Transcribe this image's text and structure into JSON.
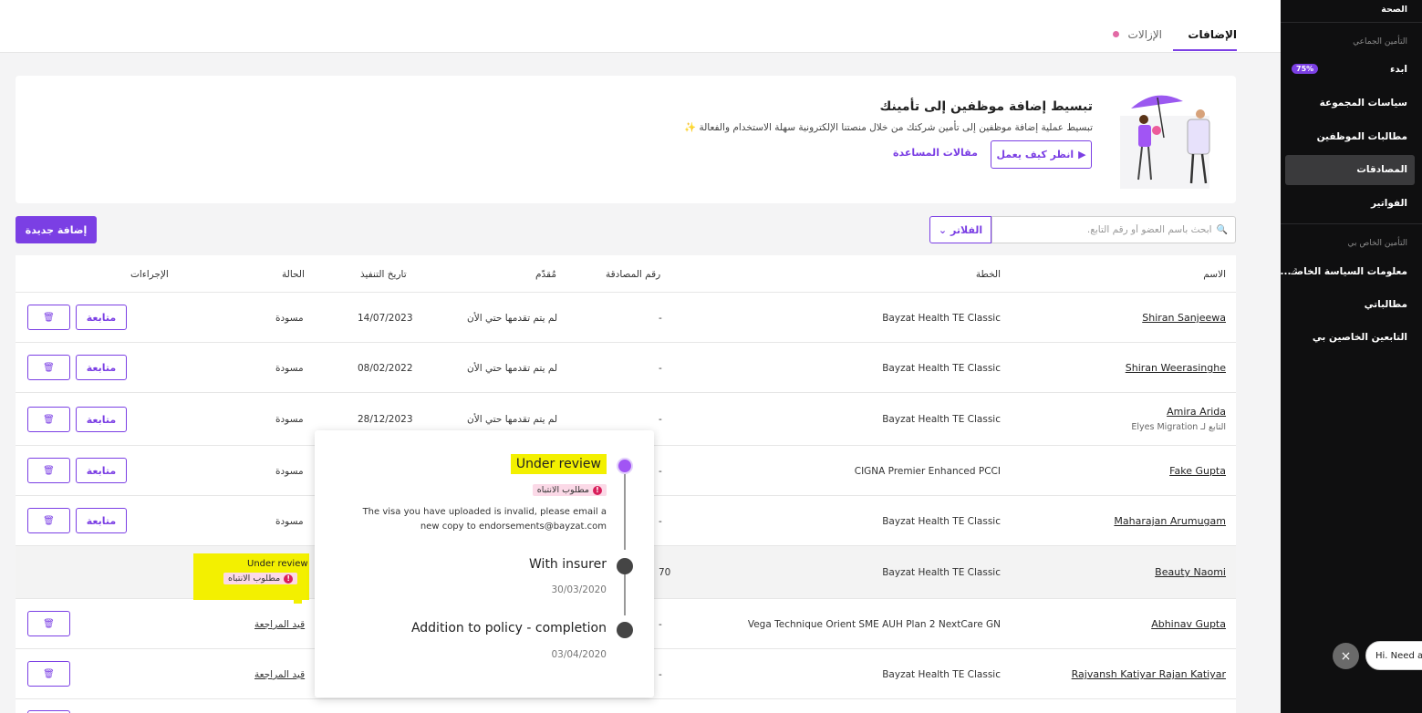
{
  "sidebar": {
    "top_item": "الصحة",
    "section_group": "التأمين الجماعي",
    "items": [
      {
        "label": "ابدء",
        "badge": "75%"
      },
      {
        "label": "سياسات المجموعة"
      },
      {
        "label": "مطالبات الموظفين"
      },
      {
        "label": "المصادقات"
      },
      {
        "label": "الفواتير"
      }
    ],
    "section_personal": "التأمين الخاص بي",
    "personal_items": [
      {
        "label": "معلومات السياسة الخاصـ..."
      },
      {
        "label": "مطالباتي"
      },
      {
        "label": "التابعين الخاصين بي"
      }
    ]
  },
  "tabs": [
    {
      "label": "الإضافات"
    },
    {
      "label": "الإزالات"
    }
  ],
  "banner": {
    "title": "تبسيط إضافة موظفين إلى تأمينك",
    "subtitle": "تبسيط عملية إضافة موظفين إلى تأمين شركتك من خلال منصتنا الإلكترونية سهلة الاستخدام والفعالة ✨",
    "how_label": "انظر كيف يعمل",
    "help_label": "مقالات المساعدة"
  },
  "toolbar": {
    "add_label": "إضافة جديدة",
    "search_placeholder": "ابحث باسم العضو أو رقم التابع.",
    "filter_label": "الفلاتر"
  },
  "table": {
    "headers": {
      "name": "الاسم",
      "plan": "الخطة",
      "ref": "رقم المصادقة",
      "submitted": "مُقدّم",
      "date": "تاريخ التنفيذ",
      "status": "الحالة",
      "actions": "الإجراءات"
    },
    "follow_label": "متابعة",
    "delete_icon": "🗑",
    "rows": [
      {
        "name": "Shiran Sanjeewa",
        "plan": "Bayzat Health TE Classic",
        "ref": "-",
        "submitted": "لم يتم تقدمها حتي الأن",
        "date": "14/07/2023",
        "status": "مسودة"
      },
      {
        "name": "Shiran Weerasinghe",
        "plan": "Bayzat Health TE Classic",
        "ref": "-",
        "submitted": "لم يتم تقدمها حتي الأن",
        "date": "08/02/2022",
        "status": "مسودة"
      },
      {
        "name": "Amira Arida",
        "sub": "التابع لـ Elyes Migration",
        "plan": "Bayzat Health TE Classic",
        "ref": "-",
        "submitted": "لم يتم تقدمها حتي الأن",
        "date": "28/12/2023",
        "status": "مسودة"
      },
      {
        "name": "Fake Gupta",
        "plan": "CIGNA Premier Enhanced PCCI",
        "ref": "-",
        "status": "مسودة"
      },
      {
        "name": "Maharajan Arumugam",
        "plan": "Bayzat Health TE Classic",
        "ref": "-",
        "status": "مسودة"
      },
      {
        "name": "Beauty Naomi",
        "plan": "Bayzat Health TE Classic",
        "ref": "70",
        "status": "Under review",
        "status_tag": "مطلوب الانتباه"
      },
      {
        "name": "Abhinav Gupta",
        "plan": "Vega Technique Orient SME AUH Plan 2 NextCare GN",
        "ref": "-",
        "status": "قيد المراجعة"
      },
      {
        "name": "Rajvansh Katiyar Rajan Katiyar",
        "plan": "Bayzat Health TE Classic",
        "ref": "-",
        "status": "قيد المراجعة"
      }
    ]
  },
  "popup": {
    "step1": {
      "title": "Under review",
      "tag": "مطلوب الانتباه",
      "message": "The visa you have uploaded is invalid, please email a new copy to endorsements@bayzat.com"
    },
    "step2": {
      "title": "With insurer",
      "date": "30/03/2020"
    },
    "step3": {
      "title": "Addition to policy - completion",
      "date": "03/04/2020"
    }
  },
  "chat": {
    "close_icon": "×",
    "text": "Hi. Need any help?"
  },
  "colors": {
    "accent": "#7b3fe4",
    "highlight": "#f3f000",
    "warning": "#d91f5b",
    "sidebar": "#0f0f10"
  }
}
